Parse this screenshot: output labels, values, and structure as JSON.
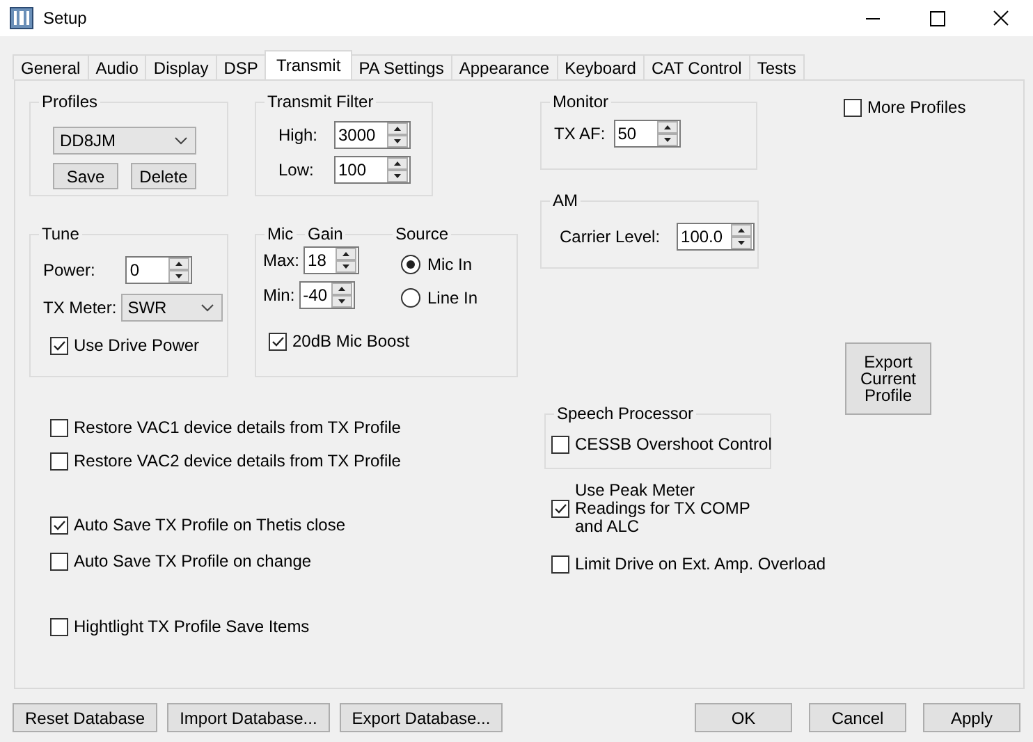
{
  "window": {
    "title": "Setup"
  },
  "tabs": [
    {
      "label": "General",
      "selected": false
    },
    {
      "label": "Audio",
      "selected": false
    },
    {
      "label": "Display",
      "selected": false
    },
    {
      "label": "DSP",
      "selected": false
    },
    {
      "label": "Transmit",
      "selected": true
    },
    {
      "label": "PA Settings",
      "selected": false
    },
    {
      "label": "Appearance",
      "selected": false
    },
    {
      "label": "Keyboard",
      "selected": false
    },
    {
      "label": "CAT Control",
      "selected": false
    },
    {
      "label": "Tests",
      "selected": false
    }
  ],
  "profiles": {
    "title": "Profiles",
    "profile": "DD8JM",
    "buttons": [
      "Save",
      "Delete"
    ]
  },
  "transmit_filter": {
    "title": "Transmit Filter",
    "fields": [
      {
        "label": "High:",
        "value": "3000"
      },
      {
        "label": "Low:",
        "value": "100"
      }
    ]
  },
  "tune": {
    "title": "Tune",
    "power": {
      "label": "Power:",
      "value": "0"
    },
    "tx_meter": {
      "label": "TX Meter:",
      "value": "SWR"
    },
    "use_drive_power": {
      "label": "Use Drive Power",
      "checked": true
    }
  },
  "mic": {
    "headings": [
      "Mic",
      "Gain"
    ],
    "fields": [
      {
        "label": "Max:",
        "value": "18"
      },
      {
        "label": "Min:",
        "value": "-40"
      }
    ],
    "source": {
      "title": "Source",
      "options": [
        {
          "label": "Mic In",
          "selected": true
        },
        {
          "label": "Line In",
          "selected": false
        }
      ]
    },
    "boost": {
      "label": "20dB Mic Boost",
      "checked": true
    }
  },
  "monitor": {
    "title": "Monitor",
    "field": {
      "label": "TX AF:",
      "value": "50"
    }
  },
  "am": {
    "title": "AM",
    "field": {
      "label": "Carrier Level:",
      "value": "100.0"
    }
  },
  "more_profiles": {
    "label": "More Profiles",
    "checked": false
  },
  "export_button": "Export Current Profile",
  "speech_processor": {
    "title": "Speech Processor",
    "option": {
      "label": "CESSB Overshoot Control",
      "checked": false
    }
  },
  "right_options": [
    {
      "label": "Use Peak Meter Readings for TX COMP and ALC",
      "checked": true
    },
    {
      "label": "Limit Drive on Ext. Amp. Overload",
      "checked": false
    }
  ],
  "left_options": [
    {
      "label": "Restore VAC1 device details from TX Profile",
      "checked": false
    },
    {
      "label": "Restore VAC2 device details from TX Profile",
      "checked": false
    },
    {
      "label": "Auto Save TX Profile on Thetis close",
      "checked": true
    },
    {
      "label": "Auto Save TX Profile on change",
      "checked": false
    },
    {
      "label": "Hightlight TX Profile Save Items",
      "checked": false
    }
  ],
  "footer": {
    "left_buttons": [
      "Reset Database",
      "Import Database...",
      "Export Database..."
    ],
    "right_buttons": [
      "OK",
      "Cancel",
      "Apply"
    ]
  }
}
